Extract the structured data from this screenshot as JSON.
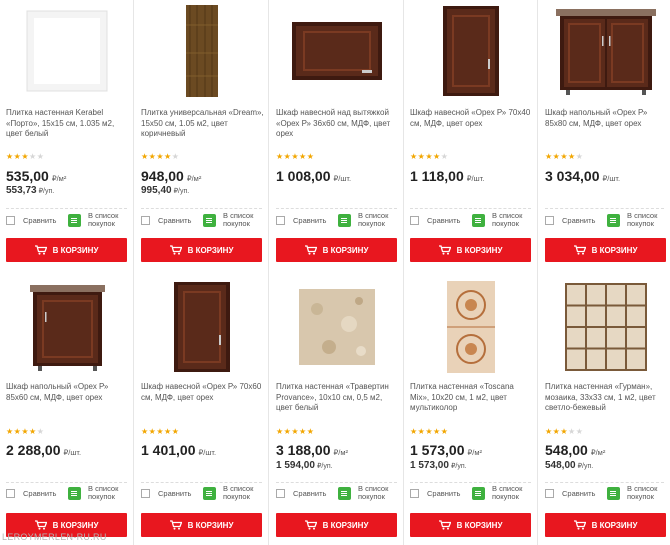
{
  "labels": {
    "compare": "Сравнить",
    "add_to_list": "В список покупок",
    "add_to_cart": "В КОРЗИНУ"
  },
  "colors": {
    "accent": "#e8171f",
    "list_icon": "#3fb13f",
    "star": "#f2a600"
  },
  "products": [
    {
      "icon": "tile-white-icon",
      "title": "Плитка настенная Kerabel «Порто», 15х15 см, 1.035 м2, цвет белый",
      "rating": 3,
      "price": "535,00",
      "price_unit": "₽/м²",
      "price2": "553,73",
      "price2_unit": "₽/уп."
    },
    {
      "icon": "tile-wood-icon",
      "title": "Плитка универсальная «Dream», 15х50 см, 1.05 м2, цвет коричневый",
      "rating": 4,
      "price": "948,00",
      "price_unit": "₽/м²",
      "price2": "995,40",
      "price2_unit": "₽/уп."
    },
    {
      "icon": "wall-cabinet-hood-icon",
      "title": "Шкаф навесной над вытяжкой «Орех Р» 36х60 см, МДФ, цвет орех",
      "rating": 5,
      "price": "1 008,00",
      "price_unit": "₽/шт.",
      "price2": "",
      "price2_unit": ""
    },
    {
      "icon": "wall-cabinet-icon",
      "title": "Шкаф навесной «Орех Р» 70х40 см, МДФ, цвет орех",
      "rating": 4,
      "price": "1 118,00",
      "price_unit": "₽/шт.",
      "price2": "",
      "price2_unit": ""
    },
    {
      "icon": "floor-cabinet-double-icon",
      "title": "Шкаф напольный «Орех Р» 85х80 см, МДФ, цвет орех",
      "rating": 4,
      "price": "3 034,00",
      "price_unit": "₽/шт.",
      "price2": "",
      "price2_unit": ""
    },
    {
      "icon": "floor-cabinet-icon",
      "title": "Шкаф напольный «Орех Р» 85х60 см, МДФ, цвет орех",
      "rating": 4,
      "price": "2 288,00",
      "price_unit": "₽/шт.",
      "price2": "",
      "price2_unit": ""
    },
    {
      "icon": "wall-cabinet-icon",
      "title": "Шкаф навесной «Орех Р» 70х60 см, МДФ, цвет орех",
      "rating": 5,
      "price": "1 401,00",
      "price_unit": "₽/шт.",
      "price2": "",
      "price2_unit": ""
    },
    {
      "icon": "tile-travertine-icon",
      "title": "Плитка настенная «Травертин Provance», 10х10 см, 0,5 м2, цвет белый",
      "rating": 5,
      "price": "3 188,00",
      "price_unit": "₽/м²",
      "price2": "1 594,00",
      "price2_unit": "₽/уп."
    },
    {
      "icon": "tile-ornament-icon",
      "title": "Плитка настенная «Toscana Mix», 10х20 см, 1 м2, цвет мультиколор",
      "rating": 5,
      "price": "1 573,00",
      "price_unit": "₽/м²",
      "price2": "1 573,00",
      "price2_unit": "₽/уп."
    },
    {
      "icon": "tile-mosaic-icon",
      "title": "Плитка настенная «Гурман», мозаика, 33х33 см, 1 м2, цвет светло-бежевый",
      "rating": 3,
      "price": "548,00",
      "price_unit": "₽/м²",
      "price2": "548,00",
      "price2_unit": "₽/уп."
    }
  ],
  "watermark": "LEROYMERLEN-RU.RU"
}
